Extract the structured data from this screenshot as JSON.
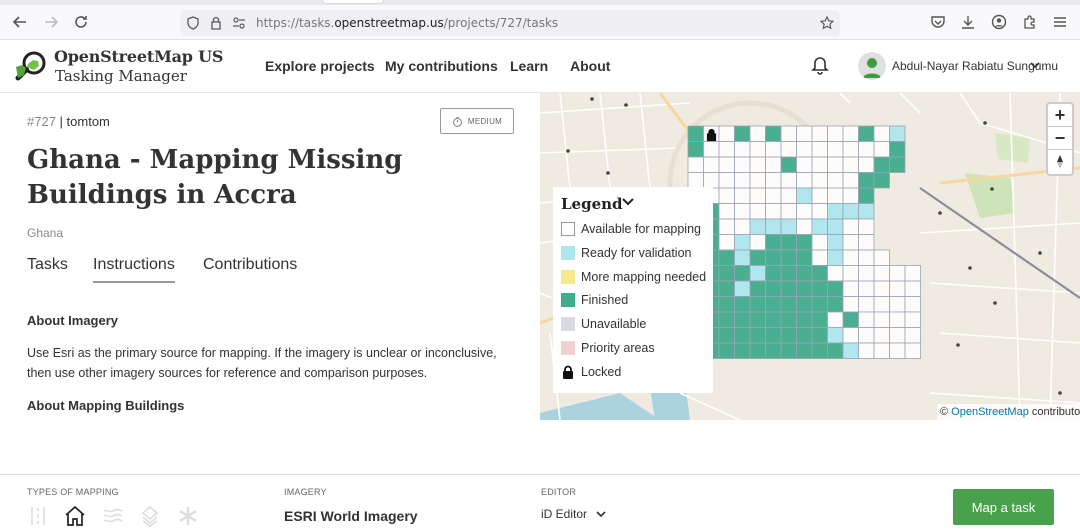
{
  "browser": {
    "url_prefix": "https://tasks.",
    "url_domain": "openstreetmap.us",
    "url_path": "/projects/727/tasks"
  },
  "header": {
    "brand_line1": "OpenStreetMap US",
    "brand_line2": "Tasking Manager",
    "nav": [
      "Explore projects",
      "My contributions",
      "Learn",
      "About"
    ],
    "user_name": "Abdul-Nayar Rabiatu Sungumu"
  },
  "project": {
    "id": "#727",
    "org": "tomtom",
    "difficulty": "MEDIUM",
    "title": "Ghana - Mapping Missing Buildings in Accra",
    "country": "Ghana",
    "tabs": [
      "Tasks",
      "Instructions",
      "Contributions"
    ],
    "active_tab": "Instructions",
    "section1_heading": "About Imagery",
    "section1_text": "Use Esri as the primary source for mapping. If the imagery is unclear or inconclusive, then use other imagery sources for reference and comparison purposes.",
    "section2_heading": "About Mapping Buildings"
  },
  "map": {
    "zoom_in": "+",
    "zoom_out": "−",
    "attribution_prefix": "©",
    "attribution_link": "OpenStreetMap",
    "attribution_suffix": "contributors",
    "legend": {
      "title": "Legend",
      "items": [
        {
          "label": "Available for mapping",
          "color": "#ffffff"
        },
        {
          "label": "Ready for validation",
          "color": "#ade6ef"
        },
        {
          "label": "More mapping needed",
          "color": "#f5e88d"
        },
        {
          "label": "Finished",
          "color": "#40ac8c"
        },
        {
          "label": "Unavailable",
          "color": "#d8dae4"
        },
        {
          "label": "Priority areas",
          "color": "#efd1d1"
        },
        {
          "label": "Locked",
          "color": "lock-icon"
        }
      ]
    }
  },
  "footer": {
    "types_label": "TYPES OF MAPPING",
    "imagery_label": "IMAGERY",
    "imagery_value": "ESRI World Imagery",
    "editor_label": "EDITOR",
    "editor_value": "iD Editor",
    "map_task_button": "Map a task",
    "type_icons": [
      "roads-icon",
      "buildings-icon",
      "waterways-icon",
      "landuse-icon",
      "other-icon"
    ]
  },
  "colors": {
    "finished": "#40ac8c",
    "validation": "#ade6ef",
    "brand_green": "#48a24b",
    "map_background": "#eee9dd"
  }
}
